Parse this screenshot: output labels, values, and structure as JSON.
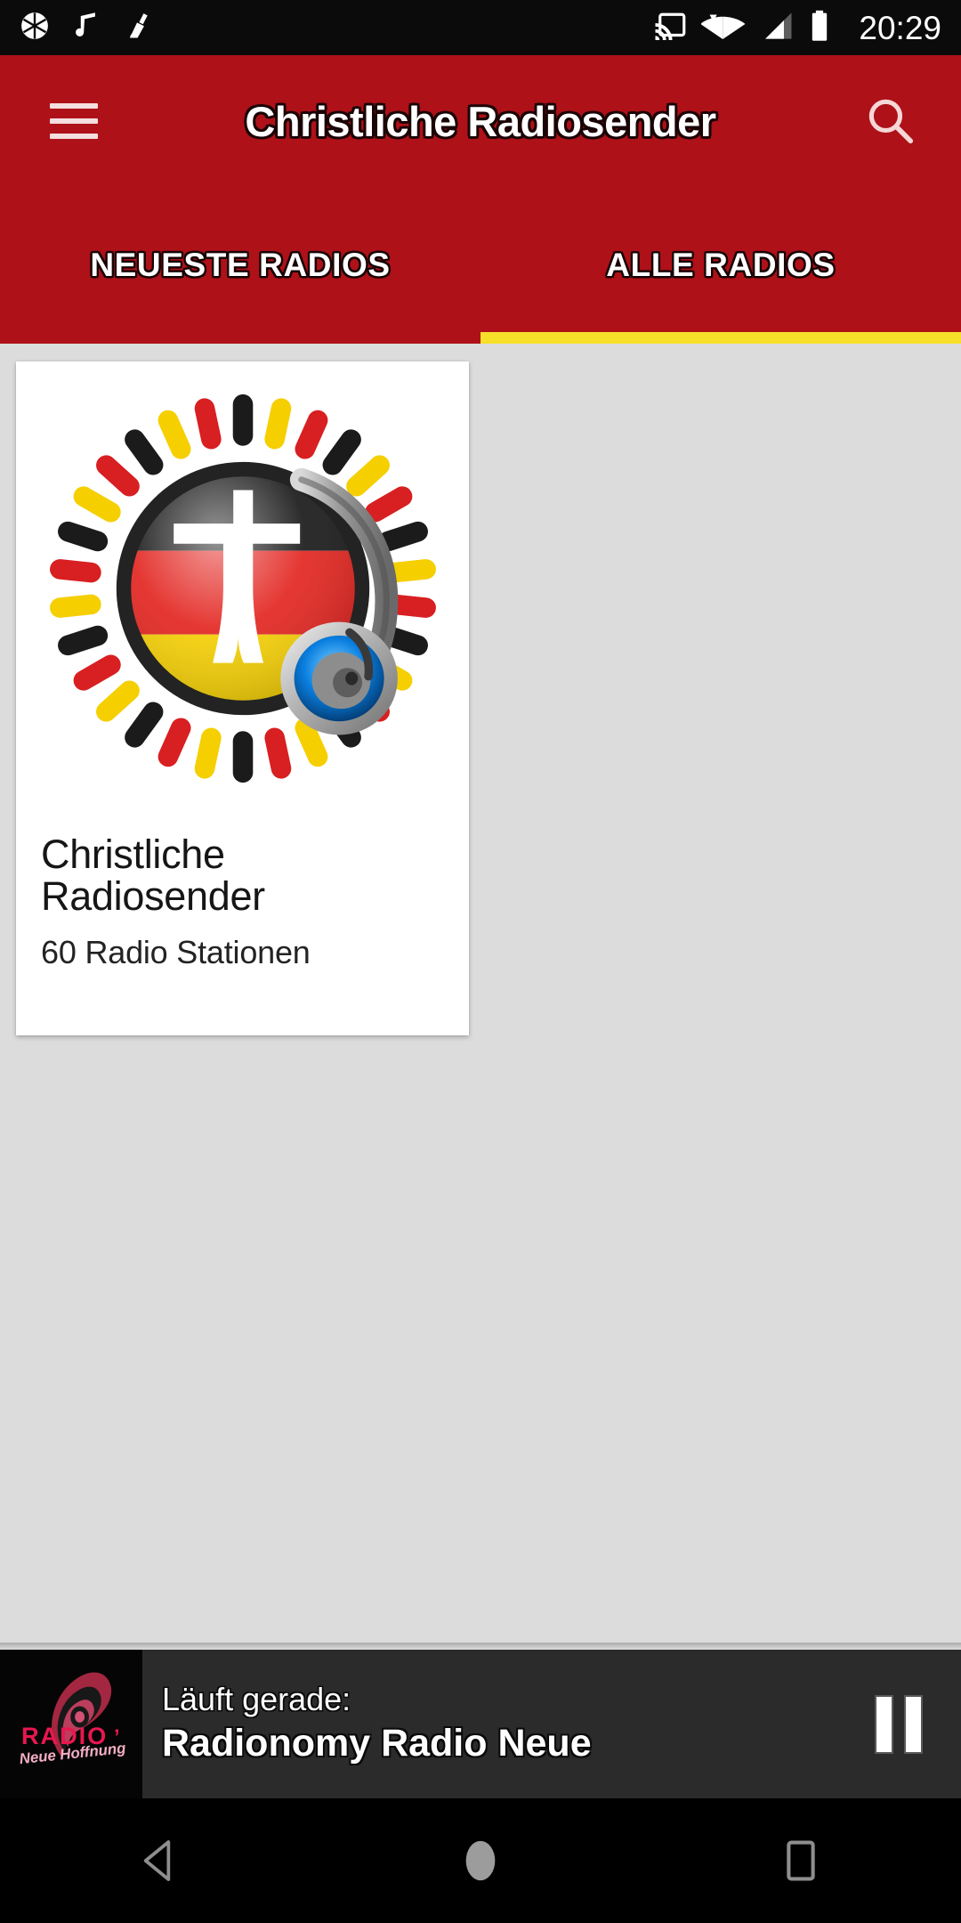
{
  "statusbar": {
    "time": "20:29",
    "left_icons": [
      "camera-aperture-icon",
      "music-note-icon",
      "broom-cleaner-icon"
    ],
    "right_icons": [
      "cast-icon",
      "wifi-icon",
      "cellular-signal-icon",
      "battery-icon"
    ]
  },
  "appbar": {
    "title": "Christliche Radiosender",
    "menu_icon": "hamburger-menu-icon",
    "search_icon": "search-icon",
    "background": "#AE1118"
  },
  "tabs": {
    "items": [
      {
        "label": "NEUESTE RADIOS",
        "active": false
      },
      {
        "label": "ALLE RADIOS",
        "active": true
      }
    ],
    "indicator_color": "#F6E02A"
  },
  "content": {
    "background": "#DCDCDC",
    "cards": [
      {
        "title": "Christliche Radiosender",
        "subtitle": "60 Radio Stationen",
        "artwork": "christliche-radiosender-logo"
      }
    ]
  },
  "player": {
    "now_playing_label": "Läuft gerade:",
    "track": "Radionomy Radio Neue",
    "thumbnail": "radio-neue-hoffnung-logo",
    "thumbnail_text_main": "RADIO",
    "thumbnail_text_sub": "Neue Hoffnung",
    "control_icon": "pause-icon",
    "background": "#2B2B2B"
  },
  "navbar": {
    "buttons": [
      "back-icon",
      "home-icon",
      "recents-icon"
    ]
  }
}
